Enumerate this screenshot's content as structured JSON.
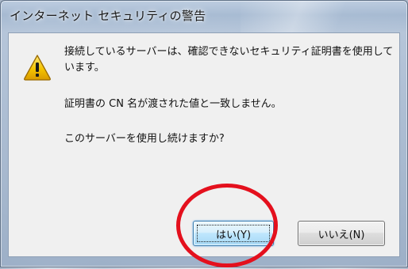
{
  "dialog": {
    "title": "インターネット セキュリティの警告",
    "messages": [
      "接続しているサーバーは、確認できないセキュリティ証明書を使用しています。",
      "証明書の CN 名が渡された値と一致しません。",
      "このサーバーを使用し続けますか?"
    ],
    "icon": "warning-icon",
    "buttons": {
      "yes_label": "はい(Y)",
      "no_label": "いいえ(N)"
    }
  },
  "colors": {
    "annotation": "#e4101d",
    "client_background": "#f0f0f0",
    "default_button_border": "#3c7fb1"
  },
  "annotation": {
    "shape": "circle",
    "target": "はい(Y)"
  }
}
